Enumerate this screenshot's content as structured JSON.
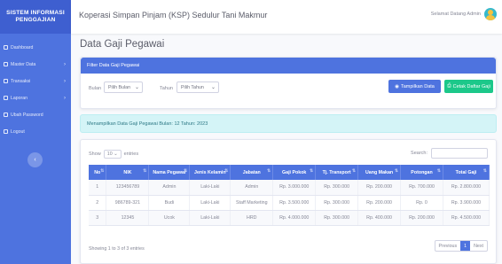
{
  "sidebar": {
    "brand": "SISTEM INFORMASI PENGGAJIAN",
    "items": [
      {
        "label": "Dashboard",
        "has_chevron": false
      },
      {
        "label": "Master Data",
        "has_chevron": true
      },
      {
        "label": "Transaksi",
        "has_chevron": true
      },
      {
        "label": "Laporan",
        "has_chevron": true
      },
      {
        "label": "Ubah Password",
        "has_chevron": false
      },
      {
        "label": "Logout",
        "has_chevron": false
      }
    ],
    "toggle_icon": "‹"
  },
  "topbar": {
    "title": "Koperasi Simpan Pinjam (KSP) Sedulur Tani Makmur",
    "user": "Selamat Datang Admin"
  },
  "page": {
    "title": "Data Gaji Pegawai"
  },
  "filter": {
    "header": "Filter Data Gaji Pegawai",
    "bulan_label": "Bulan",
    "bulan_value": "Pilih Bulan",
    "tahun_label": "Tahun",
    "tahun_value": "Pilih Tahun",
    "btn_show": "Tampilkan Data",
    "btn_print": "Cetak Daftar Gaji"
  },
  "info": "Menampilkan Data Gaji Pegawai Bulan: 12 Tahun: 2023",
  "table": {
    "show_prefix": "Show",
    "show_value": "10",
    "show_suffix": "entries",
    "search_label": "Search:",
    "headers": [
      "No",
      "NIK",
      "Nama Pegawai",
      "Jenis Kelamin",
      "Jabatan",
      "Gaji Pokok",
      "Tj. Transport",
      "Uang Makan",
      "Potongan",
      "Total Gaji"
    ],
    "rows": [
      [
        "1",
        "123456789",
        "Admin",
        "Laki-Laki",
        "Admin",
        "Rp. 3.000.000",
        "Rp. 300.000",
        "Rp. 200.000",
        "Rp. 700.000",
        "Rp. 2.800.000"
      ],
      [
        "2",
        "986789-321",
        "Budi",
        "Laki-Laki",
        "Staff Marketing",
        "Rp. 3.500.000",
        "Rp. 300.000",
        "Rp. 200.000",
        "Rp. 0",
        "Rp. 3.900.000"
      ],
      [
        "3",
        "12345",
        "Ucok",
        "Laki-Laki",
        "HRD",
        "Rp. 4.000.000",
        "Rp. 300.000",
        "Rp. 400.000",
        "Rp. 200.000",
        "Rp. 4.500.000"
      ]
    ],
    "footer_info": "Showing 1 to 3 of 3 entries",
    "pager": {
      "prev": "Previous",
      "current": "1",
      "next": "Next"
    }
  },
  "colors": {
    "primary": "#4e73df",
    "success": "#1cc88a",
    "info_bg": "#d4f4f7"
  }
}
